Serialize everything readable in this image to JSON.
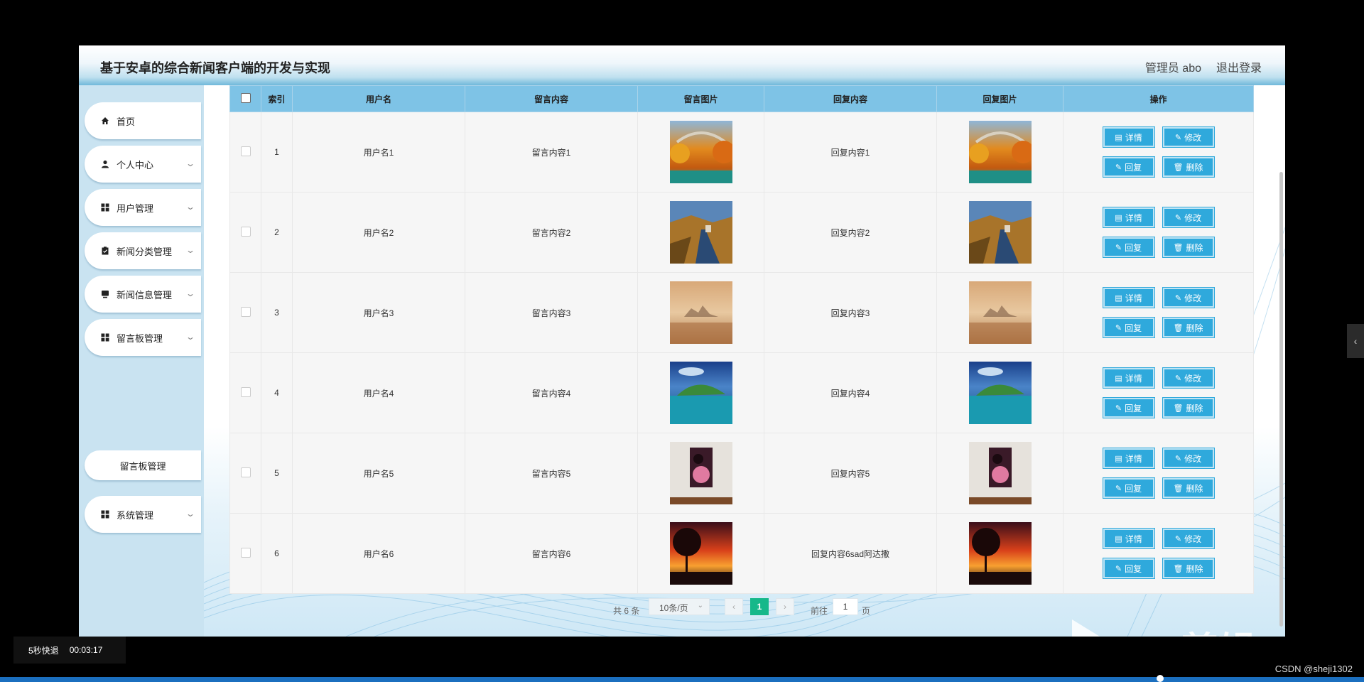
{
  "header": {
    "title": "基于安卓的综合新闻客户端的开发与实现",
    "admin": "管理员 abo",
    "logout": "退出登录"
  },
  "sidebar": {
    "items": [
      {
        "label": "首页",
        "icon": "home-icon",
        "has_chevron": false
      },
      {
        "label": "个人中心",
        "icon": "user-icon",
        "has_chevron": true
      },
      {
        "label": "用户管理",
        "icon": "grid-icon",
        "has_chevron": true
      },
      {
        "label": "新闻分类管理",
        "icon": "clipboard-icon",
        "has_chevron": true
      },
      {
        "label": "新闻信息管理",
        "icon": "monitor-icon",
        "has_chevron": true
      },
      {
        "label": "留言板管理",
        "icon": "grid-icon",
        "has_chevron": true
      },
      {
        "label": "系统管理",
        "icon": "grid-icon",
        "has_chevron": true
      }
    ],
    "sub_item": "留言板管理"
  },
  "table": {
    "headers": {
      "index": "索引",
      "username": "用户名",
      "message": "留言内容",
      "message_image": "留言图片",
      "reply": "回复内容",
      "reply_image": "回复图片",
      "actions": "操作"
    },
    "rows": [
      {
        "index": "1",
        "username": "用户名1",
        "message": "留言内容1",
        "reply": "回复内容1",
        "image": "autumn-bridge"
      },
      {
        "index": "2",
        "username": "用户名2",
        "message": "留言内容2",
        "reply": "回复内容2",
        "image": "road-valley"
      },
      {
        "index": "3",
        "username": "用户名3",
        "message": "留言内容3",
        "reply": "回复内容3",
        "image": "misty-castle"
      },
      {
        "index": "4",
        "username": "用户名4",
        "message": "留言内容4",
        "reply": "回复内容4",
        "image": "island-sea"
      },
      {
        "index": "5",
        "username": "用户名5",
        "message": "留言内容5",
        "reply": "回复内容5",
        "image": "interior-painting"
      },
      {
        "index": "6",
        "username": "用户名6",
        "message": "留言内容6",
        "reply": "回复内容6sad阿达撒",
        "image": "sunset-tree"
      }
    ],
    "actions": {
      "detail": "详情",
      "edit": "修改",
      "reply": "回复",
      "delete": "删除"
    }
  },
  "pager": {
    "total": "共 6 条",
    "page_size": "10条/页",
    "prev": "‹",
    "current": "1",
    "next": "›",
    "goto_label": "前往",
    "goto_value": "1",
    "page_unit": "页"
  },
  "overlay": {
    "speed": "5秒快退",
    "time": "00:03:17",
    "csdn": "CSDN @sheji1302",
    "watermark": "eV剪辑",
    "side_arrow": "‹"
  },
  "colors": {
    "header_accent": "#6fb8da",
    "sidebar_bg": "#c9e3f1",
    "table_header": "#7ec3e6",
    "action_button": "#2fa9dc",
    "pager_current": "#16b88a"
  }
}
